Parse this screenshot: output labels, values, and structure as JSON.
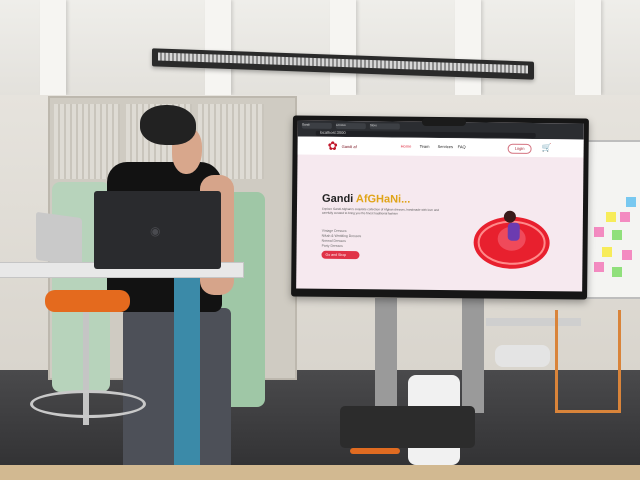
{
  "scene": {
    "colors": {
      "wall": "#e6e3dd",
      "floor": "#3a3a3c",
      "desk_leg": "#3b8aa8",
      "stool_seat": "#e46a1e",
      "brand_red": "#e03347",
      "accent_gold": "#e0a418"
    }
  },
  "screen": {
    "browser": {
      "tab1": "Gandi",
      "tab2": "Lenovo",
      "tab3": "Store",
      "url": "localhost:3000"
    },
    "site": {
      "logo_text": "Gandi af",
      "nav": {
        "home": "Home",
        "team": "Team",
        "services": "Services",
        "faq": "FAQ"
      },
      "login": "Login",
      "hero": {
        "title_main": "Gandi ",
        "title_accent": "AfGHaNi...",
        "paragraph": "Explore Gandi Afghani's exquisite collection of Afghan dresses, handmade with love and carefully curated to bring you the finest traditional fashion",
        "list": [
          "Vintage Dresses",
          "Nikah & Wedding Dresses",
          "Normal Dresses",
          "Party Dresses"
        ],
        "cta": "Go and Shop"
      }
    }
  },
  "icons": {
    "cart": "cart-icon",
    "logo": "logo-icon",
    "laptop_logo": "laptop-logo-icon"
  }
}
